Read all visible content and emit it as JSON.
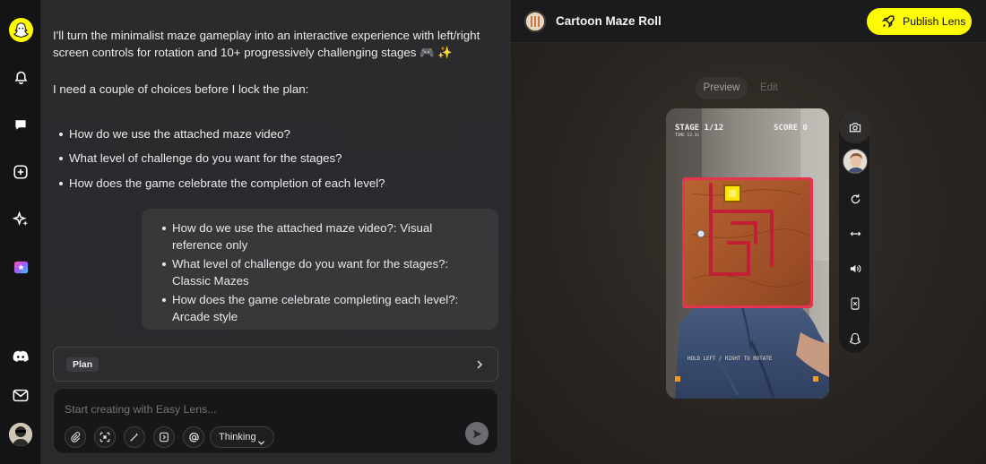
{
  "chat": {
    "intro": "I'll turn the minimalist maze gameplay into an interactive experience with left/right screen controls for rotation and 10+ progressively challenging stages 🎮 ✨",
    "need_choices": "I need a couple of choices before I lock the plan:",
    "questions": [
      "How do we use the attached maze video?",
      "What level of challenge do you want for the stages?",
      "How does the game celebrate the completion of each level?"
    ],
    "answers": [
      "How do we use the attached maze video?: Visual reference only",
      "What level of challenge do you want for the stages?: Classic Mazes",
      "How does the game celebrate completing each level?: Arcade style"
    ],
    "plan_label": "Plan",
    "composer_placeholder": "Start creating with Easy Lens...",
    "thinking_label": "Thinking"
  },
  "header": {
    "project_title": "Cartoon Maze Roll",
    "publish_label": "Publish Lens"
  },
  "preview": {
    "tabs": [
      "Preview",
      "Edit"
    ],
    "active_tab": "Preview",
    "hud_stage": "STAGE 1/12",
    "hud_time": "TIME 13.3s",
    "hud_score": "SCORE 0",
    "hud_hint": "HOLD LEFT / RIGHT TO ROTATE"
  },
  "icons": {
    "rail": [
      "snapchat-ghost-logo",
      "bell-icon",
      "chat-icon",
      "add-icon",
      "sparkle-icon",
      "lens-studio-icon",
      "discord-icon",
      "mail-icon",
      "user-avatar"
    ],
    "composer_tools": [
      "paperclip-icon",
      "scan-icon",
      "magic-wand-icon",
      "gif-icon",
      "at-icon"
    ],
    "preview_side": [
      "camera-icon",
      "face-avatar",
      "refresh-icon",
      "flip-icon",
      "audio-icon",
      "phone-icon",
      "snapchat-icon"
    ]
  },
  "colors": {
    "brand_yellow": "#fffc00",
    "maze_red": "#c01f35",
    "maze_wood": "#b35d2c",
    "goal_yellow": "#ffe600"
  }
}
